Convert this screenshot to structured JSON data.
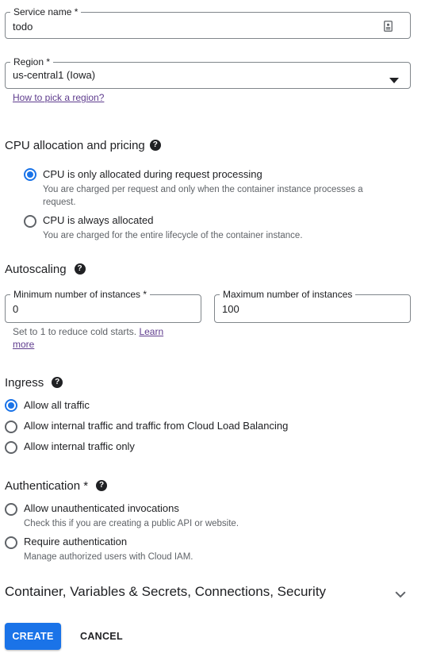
{
  "service_name": {
    "label": "Service name *",
    "value": "todo",
    "icon": "id-badge-icon"
  },
  "region": {
    "label": "Region *",
    "value": "us-central1 (Iowa)",
    "icon": "dropdown-arrow-icon",
    "help_link": "How to pick a region?"
  },
  "cpu": {
    "title": "CPU allocation and pricing",
    "options": [
      {
        "label": "CPU is only allocated during request processing",
        "desc": "You are charged per request and only when the container instance processes a request.",
        "selected": true
      },
      {
        "label": "CPU is always allocated",
        "desc": "You are charged for the entire lifecycle of the container instance.",
        "selected": false
      }
    ]
  },
  "autoscaling": {
    "title": "Autoscaling",
    "min": {
      "label": "Minimum number of instances *",
      "value": "0"
    },
    "max": {
      "label": "Maximum number of instances",
      "value": "100"
    },
    "hint": "Set to 1 to reduce cold starts.",
    "hint_link": "Learn more"
  },
  "ingress": {
    "title": "Ingress",
    "options": [
      {
        "label": "Allow all traffic",
        "selected": true
      },
      {
        "label": "Allow internal traffic and traffic from Cloud Load Balancing",
        "selected": false
      },
      {
        "label": "Allow internal traffic only",
        "selected": false
      }
    ]
  },
  "authentication": {
    "title": "Authentication *",
    "options": [
      {
        "label": "Allow unauthenticated invocations",
        "desc": "Check this if you are creating a public API or website.",
        "selected": false
      },
      {
        "label": "Require authentication",
        "desc": "Manage authorized users with Cloud IAM.",
        "selected": false
      }
    ]
  },
  "expander": {
    "title": "Container, Variables & Secrets, Connections, Security",
    "icon": "chevron-down-icon"
  },
  "actions": {
    "create": "CREATE",
    "cancel": "CANCEL"
  },
  "colors": {
    "accent": "#1a73e8",
    "link": "#5f3d8e",
    "text": "#202124",
    "secondary": "#5f6368",
    "border": "#80868b"
  }
}
